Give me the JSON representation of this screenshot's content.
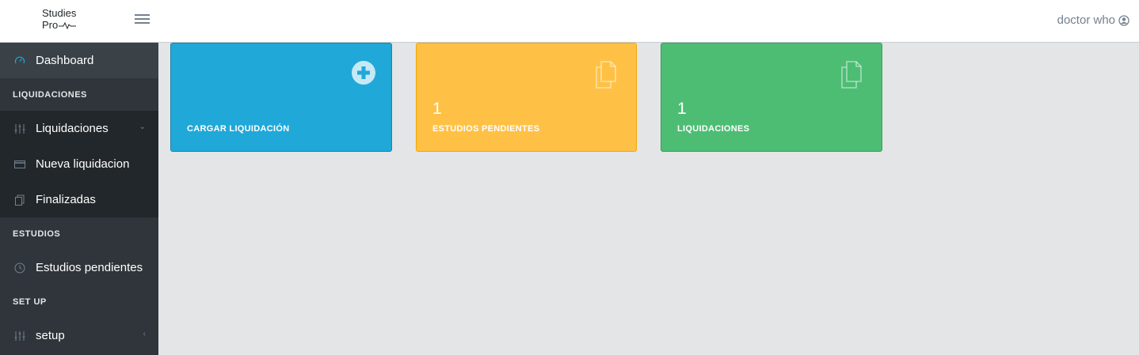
{
  "header": {
    "brand_line1": "Studies",
    "brand_line2": "Pro",
    "user_name": "doctor who"
  },
  "sidebar": {
    "dashboard": "Dashboard",
    "section_liquidaciones": "LIQUIDACIONES",
    "liquidaciones": "Liquidaciones",
    "nueva_liquidacion": "Nueva liquidacion",
    "finalizadas": "Finalizadas",
    "section_estudios": "ESTUDIOS",
    "estudios_pendientes": "Estudios pendientes",
    "section_setup": "SET UP",
    "setup": "setup"
  },
  "cards": {
    "cargar": {
      "label": "CARGAR LIQUIDACIÓN",
      "color": "#20a8d8"
    },
    "pendientes": {
      "value": "1",
      "label": "ESTUDIOS PENDIENTES",
      "color": "#ffc145"
    },
    "liquidaciones": {
      "value": "1",
      "label": "LIQUIDACIONES",
      "color": "#4dbd74"
    }
  },
  "icons": {
    "dashboard": "speedometer-icon",
    "liquidaciones": "sliders-icon",
    "nueva": "credit-card-icon",
    "finalizadas": "clipboard-icon",
    "estudios": "clock-icon",
    "setup": "sliders-icon",
    "card_cargar": "plus-circle-icon",
    "card_docs": "documents-icon",
    "user": "user-circle-icon"
  }
}
